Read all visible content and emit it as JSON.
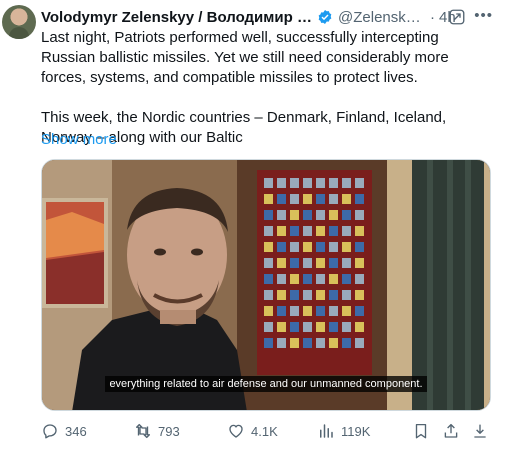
{
  "author": {
    "name": "Volodymyr Zelenskyy / Володимир Зелен…",
    "handle": "@Zelensky…",
    "separator": "·",
    "time": "4h",
    "more_label": "•••"
  },
  "tweet": {
    "text": "Last night, Patriots performed well, successfully intercepting Russian ballistic missiles. Yet we still need considerably more forces, systems, and compatible missiles to protect lives.\n\nThis week, the Nordic countries – Denmark, Finland, Iceland, Norway – along with our Baltic",
    "show_more": "Show more"
  },
  "video": {
    "caption": "everything related to air defense and our unmanned component."
  },
  "stats": {
    "replies": "346",
    "retweets": "793",
    "likes": "4.1K",
    "views": "119K"
  },
  "colors": {
    "accent": "#1d9bf0",
    "verified": "#1d9bf0",
    "secondary_text": "#536471"
  },
  "icons": {
    "reply": "reply-icon",
    "retweet": "retweet-icon",
    "like": "heart-icon",
    "views": "views-icon",
    "bookmark": "bookmark-icon",
    "share": "share-icon",
    "verified": "verified-badge-icon",
    "grok": "grok-icon"
  }
}
